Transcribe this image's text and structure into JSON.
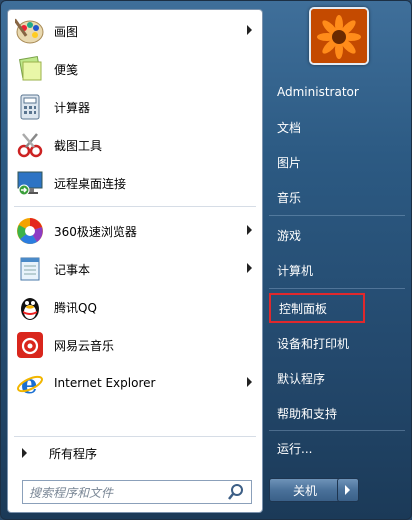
{
  "left_menu": {
    "items": [
      {
        "label": "画图",
        "icon": "paint-palette-icon",
        "has_arrow": true
      },
      {
        "label": "便笺",
        "icon": "sticky-notes-icon",
        "has_arrow": false
      },
      {
        "label": "计算器",
        "icon": "calculator-icon",
        "has_arrow": false
      },
      {
        "label": "截图工具",
        "icon": "snipping-tool-icon",
        "has_arrow": false
      },
      {
        "label": "远程桌面连接",
        "icon": "remote-desktop-icon",
        "has_arrow": false
      },
      {
        "label": "360极速浏览器",
        "icon": "browser-360-icon",
        "has_arrow": true
      },
      {
        "label": "记事本",
        "icon": "notepad-icon",
        "has_arrow": true
      },
      {
        "label": "腾讯QQ",
        "icon": "qq-penguin-icon",
        "has_arrow": false
      },
      {
        "label": "网易云音乐",
        "icon": "netease-music-icon",
        "has_arrow": false
      },
      {
        "label": "Internet Explorer",
        "icon": "internet-explorer-icon",
        "has_arrow": true
      }
    ],
    "all_programs": "所有程序",
    "search": {
      "placeholder": "搜索程序和文件"
    }
  },
  "right_menu": {
    "user": "Administrator",
    "items": [
      {
        "label": "文档"
      },
      {
        "label": "图片"
      },
      {
        "label": "音乐"
      },
      {
        "label": "游戏"
      },
      {
        "label": "计算机"
      },
      {
        "label": "控制面板",
        "highlighted": true
      },
      {
        "label": "设备和打印机"
      },
      {
        "label": "默认程序"
      },
      {
        "label": "帮助和支持"
      },
      {
        "label": "运行..."
      }
    ],
    "shutdown_label": "关机"
  },
  "colors": {
    "highlight_border": "#e0282c",
    "right_pane": "#2c5a83"
  }
}
